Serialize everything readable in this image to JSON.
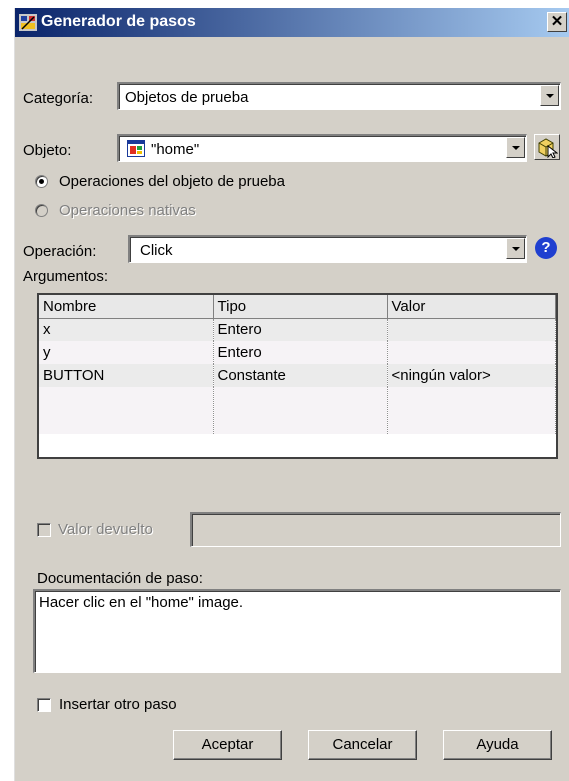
{
  "window": {
    "title": "Generador de pasos",
    "close_glyph": "✕"
  },
  "categoria": {
    "label": "Categoría:",
    "value": "Objetos de prueba"
  },
  "objeto": {
    "label": "Objeto:",
    "value": "\"home\""
  },
  "operations": {
    "test_object": "Operaciones del objeto de prueba",
    "native": "Operaciones nativas",
    "selected": "test_object"
  },
  "operacion": {
    "label": "Operación:",
    "value": "Click",
    "help_glyph": "?"
  },
  "argumentos": {
    "label": "Argumentos:",
    "columns": [
      "Nombre",
      "Tipo",
      "Valor"
    ],
    "rows": [
      [
        "x",
        "Entero",
        ""
      ],
      [
        "y",
        "Entero",
        ""
      ],
      [
        "BUTTON",
        "Constante",
        "<ningún valor>"
      ],
      [
        "",
        "",
        ""
      ]
    ]
  },
  "valor_devuelto": {
    "label": "Valor devuelto",
    "checked": false,
    "enabled": false,
    "value": ""
  },
  "documentacion": {
    "label": "Documentación de paso:",
    "text": "Hacer clic en el \"home\" image."
  },
  "insertar_otro_paso": {
    "label": "Insertar otro paso",
    "checked": false
  },
  "buttons": {
    "ok": "Aceptar",
    "cancel": "Cancelar",
    "help": "Ayuda"
  }
}
